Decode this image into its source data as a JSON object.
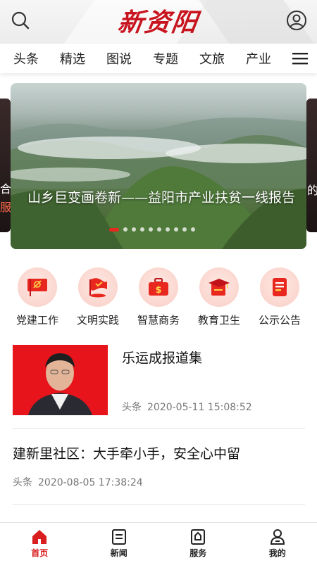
{
  "header": {
    "logo_text": "新资阳",
    "search_icon": "search-icon",
    "user_icon": "user-icon"
  },
  "nav": {
    "tabs": [
      "头条",
      "精选",
      "图说",
      "专题",
      "文旅",
      "产业"
    ],
    "menu_icon": "menu-icon"
  },
  "banner": {
    "title": "山乡巨变画卷新——益阳市产业扶贫一线报告",
    "left_peek": [
      "合",
      "服"
    ],
    "right_peek": "的",
    "slide_count": 10,
    "active_slide": 1
  },
  "categories": [
    {
      "label": "党建工作",
      "icon": "party-flag-icon"
    },
    {
      "label": "文明实践",
      "icon": "civilization-flag-icon"
    },
    {
      "label": "智慧商务",
      "icon": "briefcase-icon"
    },
    {
      "label": "教育卫生",
      "icon": "graduation-cap-icon"
    },
    {
      "label": "公示公告",
      "icon": "notice-icon"
    }
  ],
  "news": [
    {
      "title": "乐运成报道集",
      "source": "头条",
      "time": "2020-05-11 15:08:52"
    },
    {
      "title": "建新里社区：大手牵小手，安全心中留",
      "source": "头条",
      "time": "2020-08-05 17:38:24"
    }
  ],
  "tabbar": [
    {
      "label": "首页",
      "icon": "home-icon",
      "active": true
    },
    {
      "label": "新闻",
      "icon": "news-icon",
      "active": false
    },
    {
      "label": "服务",
      "icon": "service-icon",
      "active": false
    },
    {
      "label": "我的",
      "icon": "profile-icon",
      "active": false
    }
  ],
  "colors": {
    "accent": "#d81e1e",
    "icon_bg": "#fbd9d2"
  }
}
